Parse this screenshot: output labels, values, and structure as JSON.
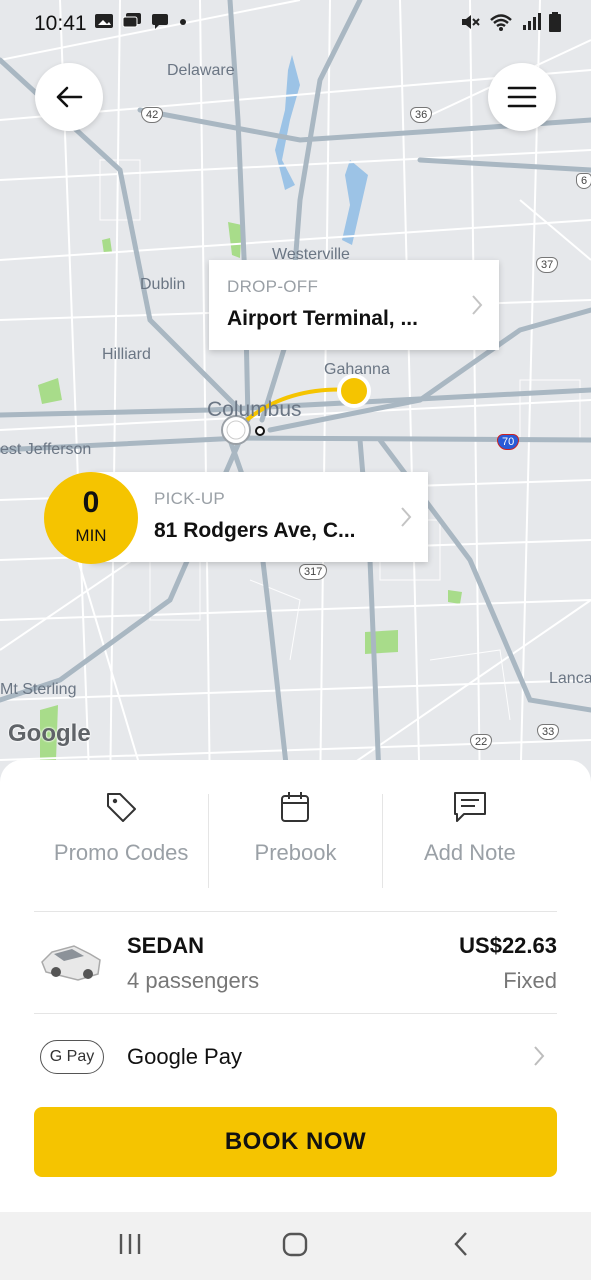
{
  "status_bar": {
    "time": "10:41"
  },
  "map": {
    "labels": {
      "delaware": "Delaware",
      "westerville": "Westerville",
      "dublin": "Dublin",
      "hilliard": "Hilliard",
      "gahanna": "Gahanna",
      "columbus": "Columbus",
      "west_jefferson": "est Jefferson",
      "mt_sterling": "Mt Sterling",
      "lancaster": "Lanca"
    },
    "shields": {
      "r42": "42",
      "r36": "36",
      "r37": "37",
      "r70": "70",
      "r317": "317",
      "r22": "22",
      "r33": "33",
      "r6": "6"
    },
    "attribution": "Google"
  },
  "dropoff": {
    "heading": "DROP-OFF",
    "address": "Airport Terminal, ..."
  },
  "pickup": {
    "heading": "PICK-UP",
    "address": "81 Rodgers Ave, C...",
    "eta_value": "0",
    "eta_unit": "MIN"
  },
  "actions": {
    "promo": "Promo Codes",
    "prebook": "Prebook",
    "note": "Add Note"
  },
  "vehicle": {
    "type": "SEDAN",
    "capacity": "4 passengers",
    "price": "US$22.63",
    "price_type": "Fixed"
  },
  "payment": {
    "badge": "G Pay",
    "method": "Google Pay"
  },
  "book_button": "BOOK NOW",
  "colors": {
    "accent": "#f5c400",
    "map_bg": "#e6e8eb",
    "road": "#ffffff",
    "highway": "#a9b7c2",
    "water": "#9cc3e6",
    "park": "#a8dc8a"
  }
}
